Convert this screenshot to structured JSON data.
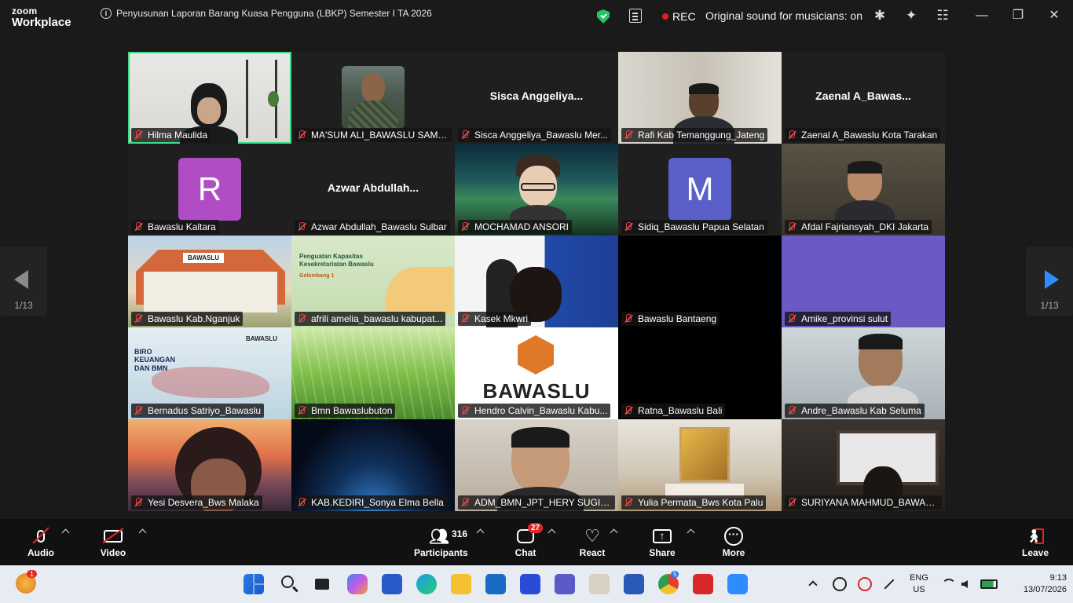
{
  "app": {
    "brand_line1": "zoom",
    "brand_line2": "Workplace"
  },
  "meeting": {
    "title": "Penyusunan Laporan Barang Kuasa Pengguna (LBKP) Semester I TA 2026"
  },
  "status": {
    "rec_label": "REC",
    "original_sound": "Original sound for musicians: on"
  },
  "pagination": {
    "left": "1/13",
    "right": "1/13"
  },
  "participants": [
    {
      "name": "Hilma Maulida"
    },
    {
      "name": "MA'SUM ALI_BAWASLU SAMP..."
    },
    {
      "name": "Sisca Anggeliya_Bawaslu Mer...",
      "display": "Sisca  Anggeliya..."
    },
    {
      "name": "Rafi Kab Temanggung_Jateng"
    },
    {
      "name": "Zaenal A_Bawaslu Kota Tarakan",
      "display": "Zaenal  A_Bawas..."
    },
    {
      "name": "Bawaslu Kaltara",
      "avatar": "R",
      "color": "#b14dc4"
    },
    {
      "name": "Azwar Abdullah_Bawaslu Sulbar",
      "display": "Azwar  Abdullah..."
    },
    {
      "name": "MOCHAMAD ANSORI"
    },
    {
      "name": "Sidiq_Bawaslu Papua Selatan",
      "avatar": "M",
      "color": "#5a5fc9"
    },
    {
      "name": "Afdal Fajriansyah_DKI Jakarta"
    },
    {
      "name": "Bawaslu Kab.Nganjuk"
    },
    {
      "name": "afrili amelia_bawaslu kabupat..."
    },
    {
      "name": "Kasek Mkwri"
    },
    {
      "name": "Bawaslu Bantaeng"
    },
    {
      "name": "Amike_provinsi sulut"
    },
    {
      "name": "Bernadus Satriyo_Bawaslu"
    },
    {
      "name": "Bmn Bawaslubuton"
    },
    {
      "name": "Hendro Calvin_Bawaslu Kabu..."
    },
    {
      "name": "Ratna_Bawaslu Bali"
    },
    {
      "name": "Andre_Bawaslu Kab Seluma"
    },
    {
      "name": "Yesi Desvera_Bws Malaka"
    },
    {
      "name": "KAB.KEDIRI_Sonya Elma Bella"
    },
    {
      "name": "ADM_BMN_JPT_HERY SUGIAR..."
    },
    {
      "name": "Yulia Permata_Bws Kota Palu"
    },
    {
      "name": "SURIYANA MAHMUD_BAWASL..."
    }
  ],
  "backgrounds": {
    "bawaslu_banner": "BAWASLU",
    "training_title": "Penguatan Kapasitas Kesekretariatan Bawaslu",
    "training_sub": "Gelombang 1",
    "biro_text": "BIRO KEUANGAN DAN BMN",
    "logo_text": "BAWASLU"
  },
  "toolbar": {
    "audio": "Audio",
    "video": "Video",
    "participants": "Participants",
    "participants_count": "316",
    "chat": "Chat",
    "chat_badge": "27",
    "react": "React",
    "share": "Share",
    "more": "More",
    "leave": "Leave"
  },
  "taskbar": {
    "lang1": "ENG",
    "lang2": "US",
    "time": "9:13",
    "date": "13/07/2026",
    "notif_badge": "1",
    "chrome_badge": "5"
  }
}
